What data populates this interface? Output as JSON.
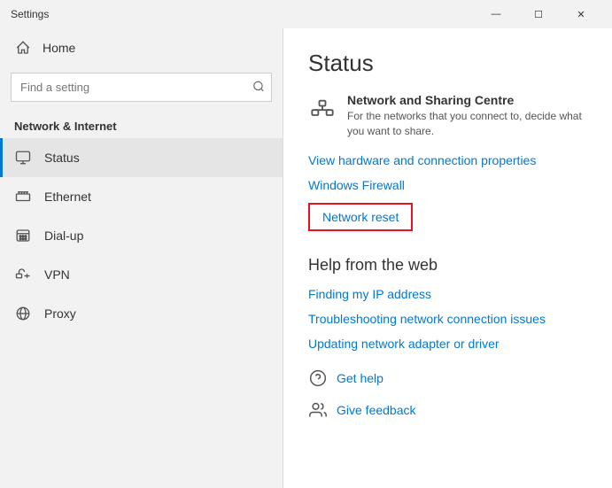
{
  "titlebar": {
    "title": "Settings",
    "minimize": "—",
    "maximize": "☐"
  },
  "sidebar": {
    "home_label": "Home",
    "search_placeholder": "Find a setting",
    "category_label": "Network & Internet",
    "items": [
      {
        "id": "status",
        "label": "Status",
        "active": true
      },
      {
        "id": "ethernet",
        "label": "Ethernet",
        "active": false
      },
      {
        "id": "dialup",
        "label": "Dial-up",
        "active": false
      },
      {
        "id": "vpn",
        "label": "VPN",
        "active": false
      },
      {
        "id": "proxy",
        "label": "Proxy",
        "active": false
      }
    ]
  },
  "main": {
    "title": "Status",
    "network_sharing": {
      "heading": "Network and Sharing Centre",
      "description": "For the networks that you connect to, decide what you want to share."
    },
    "links": {
      "view_hardware": "View hardware and connection properties",
      "windows_firewall": "Windows Firewall",
      "network_reset": "Network reset"
    },
    "help_section": {
      "title": "Help from the web",
      "links": [
        "Finding my IP address",
        "Troubleshooting network connection issues",
        "Updating network adapter or driver"
      ]
    },
    "bottom": {
      "get_help": "Get help",
      "give_feedback": "Give feedback"
    }
  }
}
